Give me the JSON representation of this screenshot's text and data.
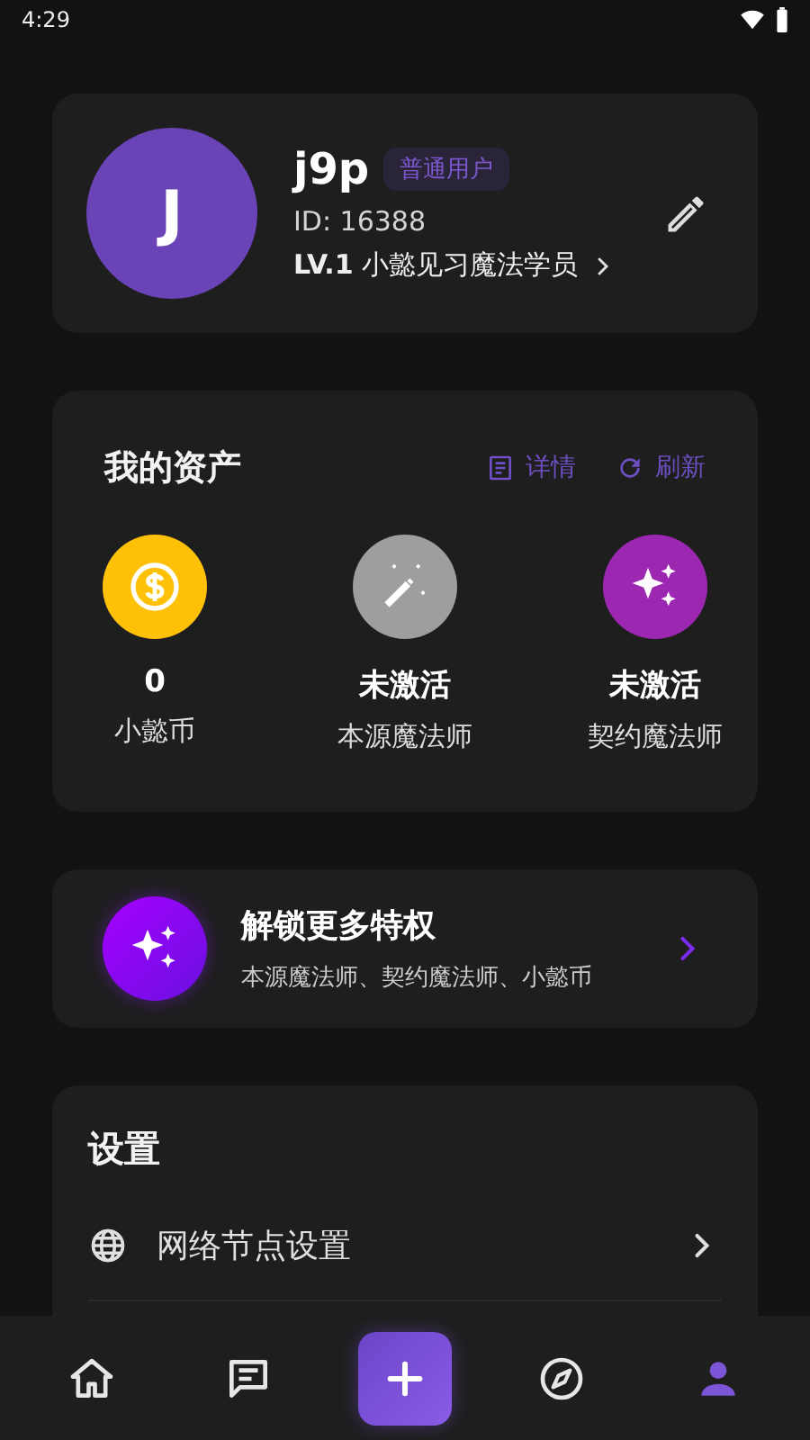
{
  "status_bar": {
    "time": "4:29"
  },
  "profile": {
    "avatar_letter": "J",
    "name": "j9p",
    "badge": "普通用户",
    "id": "ID: 16388",
    "level": "LV.1",
    "level_title": "小懿见习魔法学员"
  },
  "assets": {
    "title": "我的资产",
    "actions": [
      {
        "kind": "details",
        "label": "详情"
      },
      {
        "kind": "refresh",
        "label": "刷新"
      }
    ],
    "items": [
      {
        "kind": "coin",
        "color": "#ffc107",
        "value": "0",
        "label": "小懿币"
      },
      {
        "kind": "wand",
        "color": "#9e9e9e",
        "value": "未激活",
        "label": "本源魔法师"
      },
      {
        "kind": "sparkle",
        "color": "#9c27b0",
        "value": "未激活",
        "label": "契约魔法师"
      }
    ]
  },
  "promo": {
    "title": "解锁更多特权",
    "subtitle": "本源魔法师、契约魔法师、小懿币"
  },
  "settings": {
    "title": "设置",
    "items": [
      {
        "kind": "network",
        "label": "网络节点设置"
      }
    ]
  },
  "bottom_nav": [
    {
      "kind": "home",
      "selected": false
    },
    {
      "kind": "chat",
      "selected": false
    },
    {
      "kind": "add",
      "selected": false
    },
    {
      "kind": "explore",
      "selected": false
    },
    {
      "kind": "profile",
      "selected": true
    }
  ]
}
